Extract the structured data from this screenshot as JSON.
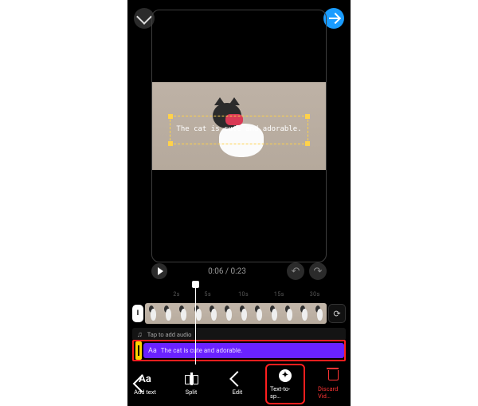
{
  "header": {
    "collapse_icon": "chevron-down",
    "continue_icon": "arrow-right"
  },
  "preview": {
    "overlay_text": "The cat is cute and adorable."
  },
  "playback": {
    "current": "0:06",
    "duration": "0:23",
    "time_display": "0:06 / 0:23"
  },
  "ruler": {
    "marks": [
      "2s",
      "5s",
      "10s",
      "15s",
      "30s"
    ]
  },
  "tracks": {
    "audio_placeholder": "Tap to add audio",
    "text_layer": "The cat is cute and adorable."
  },
  "toolbar": {
    "items": [
      {
        "id": "add-text",
        "label": "Add text",
        "icon": "Aa"
      },
      {
        "id": "split",
        "label": "Split",
        "icon": "split"
      },
      {
        "id": "edit",
        "label": "Edit",
        "icon": "pencil"
      },
      {
        "id": "tts",
        "label": "Text-to-sp…",
        "icon": "tts",
        "highlight": true
      },
      {
        "id": "discard",
        "label": "Discard Vid…",
        "icon": "trash",
        "danger": true
      }
    ]
  }
}
